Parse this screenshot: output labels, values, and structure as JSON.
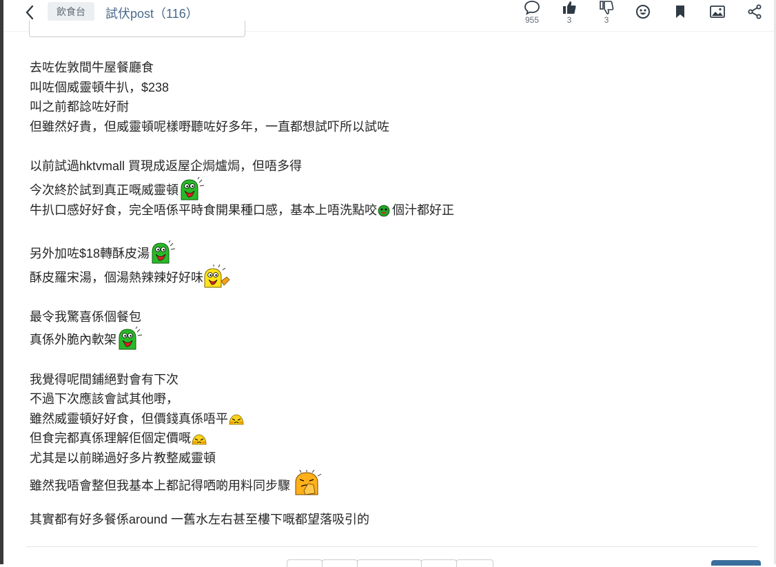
{
  "header": {
    "channel": "飲食台",
    "title": "試伏post（116）",
    "comments_count": "955",
    "likes_count": "3",
    "dislikes_count": "3"
  },
  "post": {
    "lines": [
      "去咗佐敦間牛屋餐廳食",
      "叫咗個威靈頓牛扒，$238",
      "叫之前都諗咗好耐",
      "但雖然好貴，但威靈頓呢樣嘢聽咗好多年，一直都想試吓所以試咗",
      "",
      "以前試過hktvmall 買現成返屋企焗爐焗，但唔多得",
      "今次終於試到真正嘅威靈頓",
      "牛扒口感好好食，完全唔係平時食開果種口感，基本上唔洗點咬",
      "個汁都好正",
      "",
      "另外加咗$18轉酥皮湯",
      "酥皮羅宋湯，個湯熱辣辣好好味",
      "",
      "最令我驚喜係個餐包",
      "真係外脆內軟架",
      "",
      "我覺得呢間鋪絕對會有下次",
      "不過下次應該會試其他嘢，",
      "雖然威靈頓好好食，但價錢真係唔平",
      "但食完都真係理解佢個定價嘅",
      "尤其是以前睇過好多片教整威靈頓",
      "雖然我唔會整但我基本上都記得哂啲用料同步驟",
      "",
      "其實都有好多餐係around 一舊水左右甚至樓下嘅都望落吸引的"
    ]
  },
  "icons": {
    "back": "chevron-left-icon",
    "comments": "comment-bubble-icon",
    "like": "thumbs-up-icon",
    "dislike": "thumbs-down-icon",
    "emoji": "emoji-face-icon",
    "bookmark": "bookmark-icon",
    "image": "image-icon",
    "share": "share-icon"
  },
  "colors": {
    "title": "#4a6a8a",
    "icon": "#2f3a45",
    "chip_bg": "#eceff1",
    "reply_button": "#3a6e9c"
  }
}
